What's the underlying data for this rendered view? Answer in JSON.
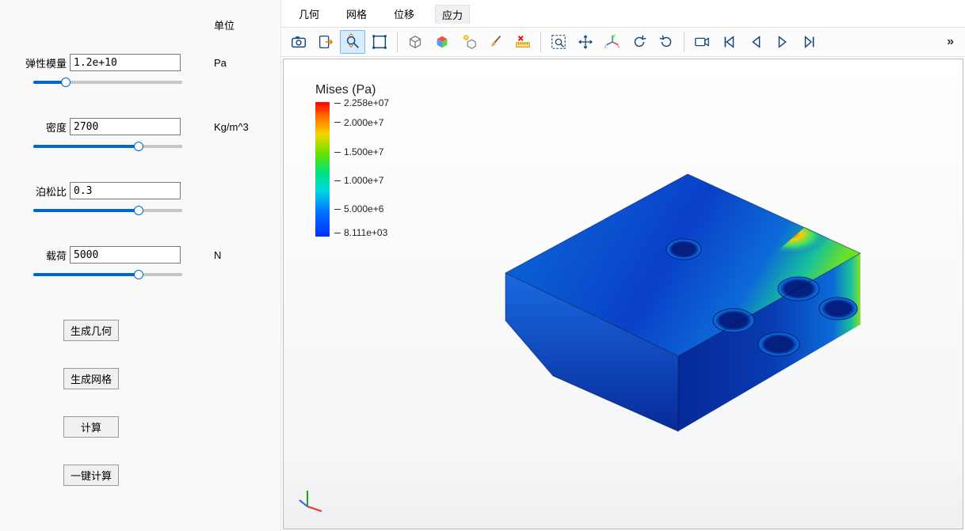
{
  "sidebar": {
    "unit_header": "单位",
    "params": {
      "modulus": {
        "label": "弹性模量",
        "value": "1.2e+10",
        "unit": "Pa",
        "slider_pct": 20
      },
      "density": {
        "label": "密度",
        "value": "2700",
        "unit": "Kg/m^3",
        "slider_pct": 72
      },
      "poisson": {
        "label": "泊松比",
        "value": "0.3",
        "unit": "",
        "slider_pct": 72
      },
      "load": {
        "label": "载荷",
        "value": "5000",
        "unit": "N",
        "slider_pct": 72
      }
    },
    "buttons": {
      "gen_geom": "生成几何",
      "gen_mesh": "生成网格",
      "compute": "计算",
      "one_click": "一键计算"
    }
  },
  "tabs": {
    "geometry": "几何",
    "mesh": "网格",
    "displacement": "位移",
    "stress": "应力",
    "active": "stress"
  },
  "toolbar_icons": [
    "camera-icon",
    "export-icon",
    "zoom-fit-icon",
    "select-box-icon",
    "cube-icon",
    "cube-color-icon",
    "light-cube-icon",
    "brush-icon",
    "ruler-x-icon",
    "zoom-area-icon",
    "pan-icon",
    "axes-icon",
    "rotate-ccw-icon",
    "rotate-cw-icon",
    "camera-record-icon",
    "skip-start-icon",
    "step-back-icon",
    "play-icon",
    "step-fwd-icon"
  ],
  "legend": {
    "title": "Mises (Pa)",
    "ticks": [
      {
        "label": "2.258e+07",
        "pos": 0
      },
      {
        "label": "2.000e+7",
        "pos": 15
      },
      {
        "label": "1.500e+7",
        "pos": 38
      },
      {
        "label": "1.000e+7",
        "pos": 60
      },
      {
        "label": "5.000e+6",
        "pos": 82
      },
      {
        "label": "8.111e+03",
        "pos": 100
      }
    ]
  },
  "chart_data": {
    "type": "heatmap",
    "title": "Mises (Pa)",
    "colorbar": {
      "label": "Mises (Pa)",
      "min": 8111,
      "max": 22580000,
      "ticks": [
        22580000,
        20000000,
        15000000,
        10000000,
        5000000,
        8111
      ],
      "tick_labels": [
        "2.258e+07",
        "2.000e+7",
        "1.500e+7",
        "1.000e+7",
        "5.000e+6",
        "8.111e+03"
      ],
      "colormap": "jet"
    },
    "description": "3D solid von Mises stress contour on a chamfered rectangular block with four circular holes; most of the body ~1e6–5e6 Pa (blue/cyan), stress concentrations (green/yellow/red up to ~2.26e7 Pa) near right-side hole edges and top-right corner."
  }
}
